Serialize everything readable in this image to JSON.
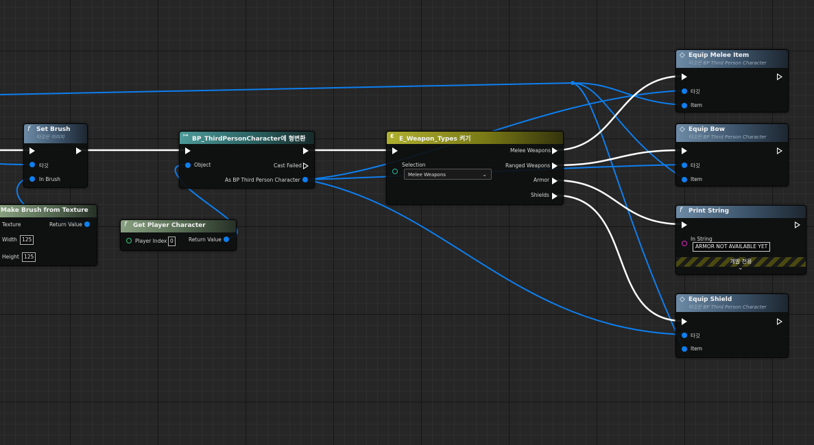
{
  "nodes": {
    "set_brush": {
      "title": "Set Brush",
      "subtitle": "타깃은 이미지",
      "pins": {
        "target": "타깃",
        "in_brush": "In Brush"
      }
    },
    "make_brush": {
      "title": "Make Brush from Texture",
      "pins": {
        "texture": "Texture",
        "return_value": "Return Value",
        "width": "Width",
        "height": "Height"
      },
      "values": {
        "width": "125",
        "height": "125"
      }
    },
    "get_player": {
      "title": "Get Player Character",
      "pins": {
        "player_index": "Player Index",
        "return_value": "Return Value"
      },
      "values": {
        "player_index": "0"
      }
    },
    "cast": {
      "title": "BP_ThirdPersonCharacter에 형변환",
      "pins": {
        "object": "Object",
        "cast_failed": "Cast Failed",
        "as_bp": "As BP Third Person Character"
      }
    },
    "switch": {
      "title": "E_Weapon_Types 켜기",
      "pins": {
        "selection": "Selection",
        "melee": "Melee Weapons",
        "ranged": "Ranged Weapons",
        "armor": "Armor",
        "shields": "Shields"
      },
      "selection_value": "Melee Weapons"
    },
    "equip_melee": {
      "title": "Equip Melee Item",
      "subtitle": "타깃은 BP Third Person Character",
      "pins": {
        "target": "타깃",
        "item": "Item"
      }
    },
    "equip_bow": {
      "title": "Equip Bow",
      "subtitle": "타깃은 BP Third Person Character",
      "pins": {
        "target": "타깃",
        "item": "Item"
      }
    },
    "print_string": {
      "title": "Print String",
      "pins": {
        "in_string": "In String"
      },
      "in_string_value": "ARMOR NOT AVAILABLE YET",
      "dev_only": "개발 전용"
    },
    "equip_shield": {
      "title": "Equip Shield",
      "subtitle": "타깃은 BP Third Person Character",
      "pins": {
        "target": "타깃",
        "item": "Item"
      }
    }
  },
  "icons": {
    "function": "function-icon",
    "event": "event-diamond-icon",
    "cast": "cast-arrow-icon",
    "switch": "switch-icon",
    "dropdown": "chevron-down-icon",
    "expand": "chevron-down-icon"
  },
  "colors": {
    "exec_wire": "#ffffff",
    "object_wire": "#0d7ff0",
    "function_header": "#6d8ba6",
    "pure_header": "#88a080",
    "cast_header": "#4e9a9a",
    "switch_header": "#b0b030",
    "string_pin": "#e020c0"
  }
}
